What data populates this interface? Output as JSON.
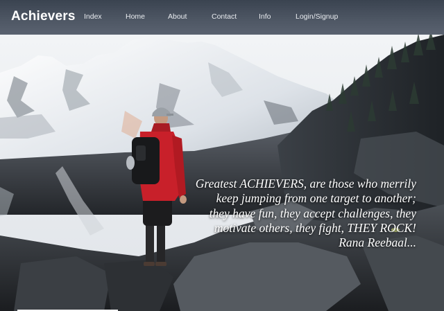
{
  "brand": {
    "title": "Achievers"
  },
  "nav": {
    "links": [
      {
        "label": "Index"
      },
      {
        "label": "Home"
      },
      {
        "label": "About"
      },
      {
        "label": "Contact"
      },
      {
        "label": "Info"
      },
      {
        "label": "Login/Signup"
      }
    ]
  },
  "hero": {
    "quote": "Greatest ACHIEVERS, are those who merrily keep jumping from one target to another; they have fun, they accept challenges, they motivate others, they fight, THEY ROCK!",
    "author": "Rana Reebaal..."
  },
  "colors": {
    "navbar": "#4d5663",
    "text": "#ffffff",
    "jacket": "#c8202a"
  }
}
